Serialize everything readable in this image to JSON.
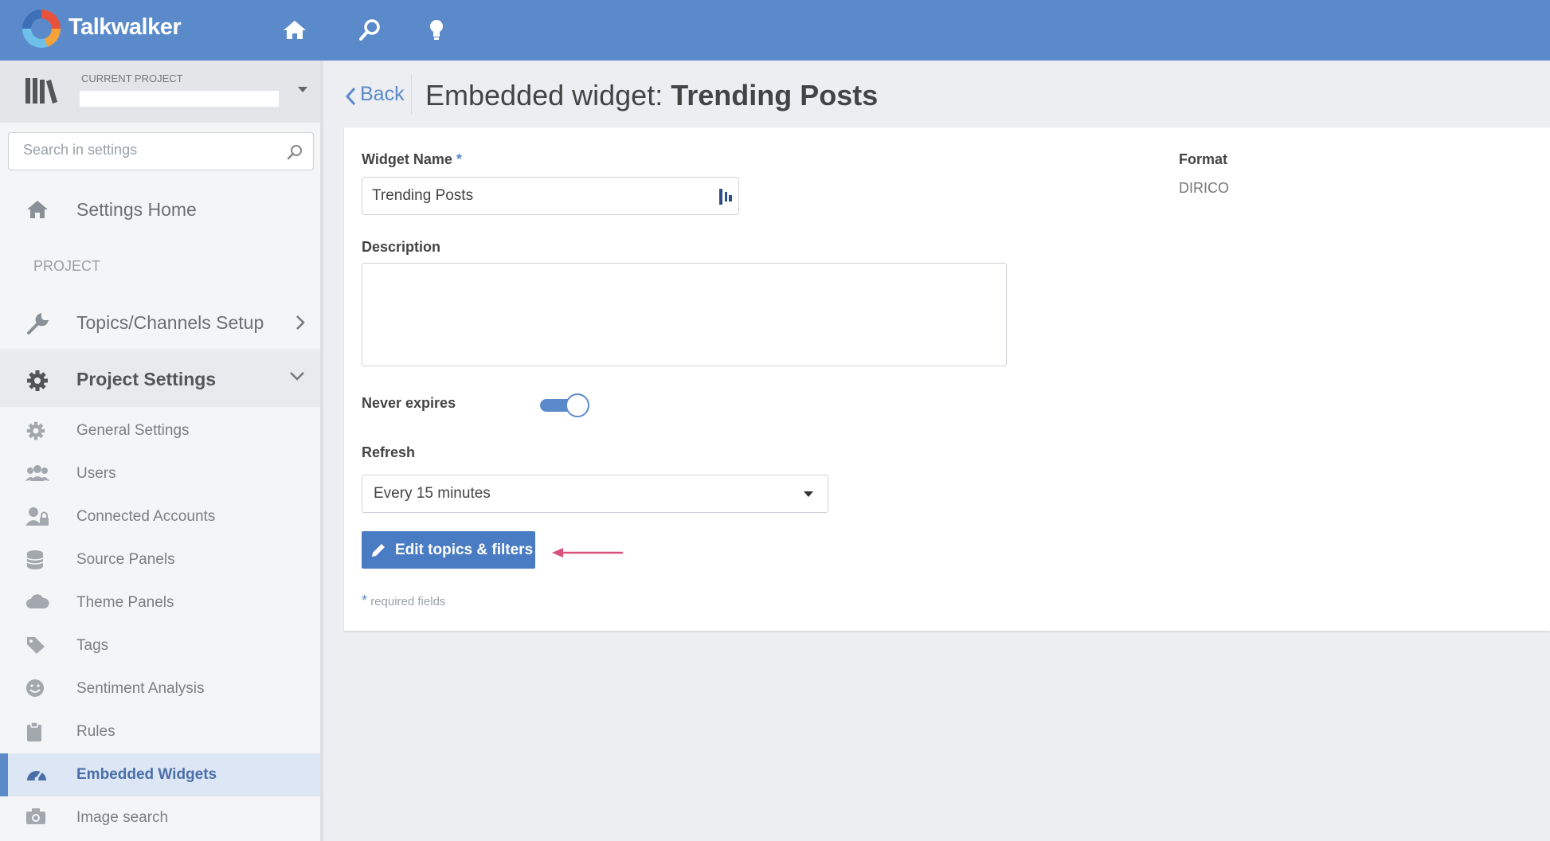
{
  "app": {
    "brand": "Talkwalker"
  },
  "sidebar": {
    "project_label": "CURRENT PROJECT",
    "search_placeholder": "Search in settings",
    "settings_home": "Settings Home",
    "section_project": "PROJECT",
    "topics_setup": "Topics/Channels Setup",
    "project_settings": "Project Settings",
    "items": [
      {
        "label": "General Settings",
        "icon": "gear-icon"
      },
      {
        "label": "Users",
        "icon": "users-icon"
      },
      {
        "label": "Connected Accounts",
        "icon": "connected-accounts-icon"
      },
      {
        "label": "Source Panels",
        "icon": "database-icon"
      },
      {
        "label": "Theme Panels",
        "icon": "cloud-icon"
      },
      {
        "label": "Tags",
        "icon": "tag-icon"
      },
      {
        "label": "Sentiment Analysis",
        "icon": "smiley-icon"
      },
      {
        "label": "Rules",
        "icon": "clipboard-icon"
      },
      {
        "label": "Embedded Widgets",
        "icon": "dashboard-icon",
        "active": true
      },
      {
        "label": "Image search",
        "icon": "camera-icon"
      }
    ]
  },
  "header": {
    "back": "Back",
    "title_prefix": "Embedded widget: ",
    "title_name": "Trending Posts"
  },
  "form": {
    "widget_name_label": "Widget Name",
    "required_star": "*",
    "widget_name_value": "Trending Posts",
    "description_label": "Description",
    "never_expires_label": "Never expires",
    "never_expires_on": true,
    "refresh_label": "Refresh",
    "refresh_value": "Every 15 minutes",
    "edit_button": "Edit topics & filters",
    "required_note": "required fields",
    "format_label": "Format",
    "format_value": "DIRICO"
  },
  "colors": {
    "accent": "#5b8acb",
    "arrow": "#d9507a"
  }
}
